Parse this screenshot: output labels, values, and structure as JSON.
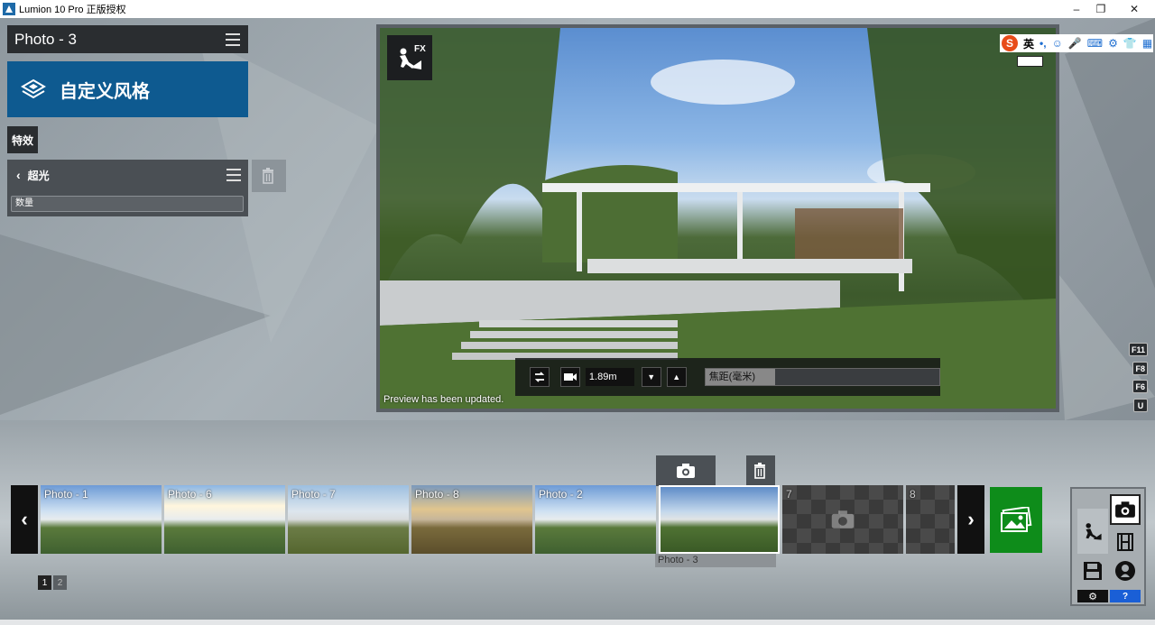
{
  "window": {
    "title": "Lumion 10 Pro 正版授权"
  },
  "left_panel": {
    "photo_title": "Photo - 3",
    "style_label": "自定义风格",
    "effects_tab": "特效",
    "effect_name": "超光",
    "quantity_label": "数量"
  },
  "preview": {
    "fx_label": "FX",
    "status": "Preview has been updated.",
    "camera_height": "1.89m",
    "focal_label": "焦距(毫米)"
  },
  "ime": {
    "lang": "英"
  },
  "shortcuts": [
    "F11",
    "F8",
    "F6",
    "U"
  ],
  "filmstrip": {
    "thumbnails": [
      {
        "label": "Photo - 1"
      },
      {
        "label": "Photo - 6"
      },
      {
        "label": "Photo - 7"
      },
      {
        "label": "Photo - 8"
      },
      {
        "label": "Photo - 2"
      },
      {
        "label": ""
      },
      {
        "label": "7"
      },
      {
        "label": "8"
      }
    ],
    "selected_caption": "Photo - 3",
    "pages": [
      "1",
      "2"
    ]
  },
  "help_label": "?",
  "colors": {
    "accent_blue": "#0e5a90",
    "gallery_green": "#0e8c1a",
    "help_blue": "#1a5fd6"
  }
}
